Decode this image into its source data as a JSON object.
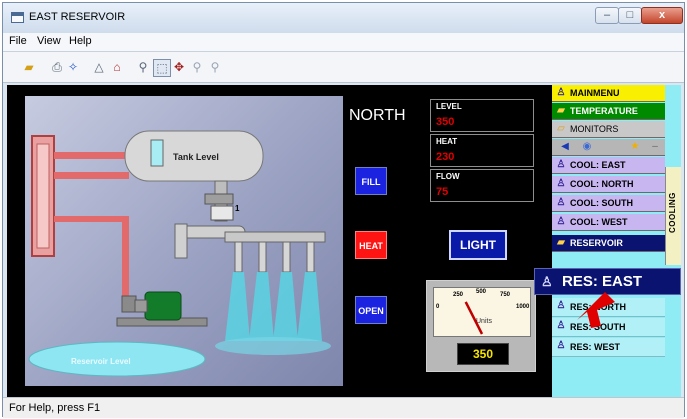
{
  "window": {
    "title": "EAST RESERVOIR",
    "minimize": "–",
    "maximize": "□",
    "close": "x"
  },
  "menu": [
    "File",
    "View",
    "Help"
  ],
  "toolbar_icons": [
    "open-folder-icon",
    "print-icon",
    "help-pointer-icon",
    "connect-icon",
    "home-icon",
    "zoom-icon",
    "select-zoom-icon",
    "pan-icon",
    "zoom-in-icon",
    "zoom-out-icon"
  ],
  "scene": {
    "tank_label": "Tank Level",
    "reservoir_label": "Reservoir Level",
    "valve_number": "1"
  },
  "location": "NORTH",
  "readouts": [
    {
      "label": "LEVEL",
      "value": "350"
    },
    {
      "label": "HEAT",
      "value": "230"
    },
    {
      "label": "FLOW",
      "value": "75"
    }
  ],
  "buttons": {
    "fill": "FILL",
    "heat": "HEAT",
    "open": "OPEN",
    "light": "LIGHT"
  },
  "gauge": {
    "ticks": [
      "0",
      "250",
      "500",
      "750",
      "1000"
    ],
    "units": "Units",
    "value": "350",
    "min": 0,
    "max": 1000
  },
  "nav": {
    "main": "MAINMENU",
    "temperature": "TEMPERATURE",
    "monitors": "MONITORS",
    "cooling": [
      "COOL: EAST",
      "COOL: NORTH",
      "COOL: SOUTH",
      "COOL: WEST"
    ],
    "cooling_tab": "COOLING",
    "reservoir": "RESERVOIR",
    "res_items": [
      "RES: NORTH",
      "RES: SOUTH",
      "RES: WEST"
    ],
    "tooltip": "RES: EAST"
  },
  "status": "For Help, press F1",
  "colors": {
    "accent_red": "#ff1414",
    "button_blue": "#1b22e0",
    "nav_bg": "#90ecf4",
    "readout_value": "#e00000"
  }
}
